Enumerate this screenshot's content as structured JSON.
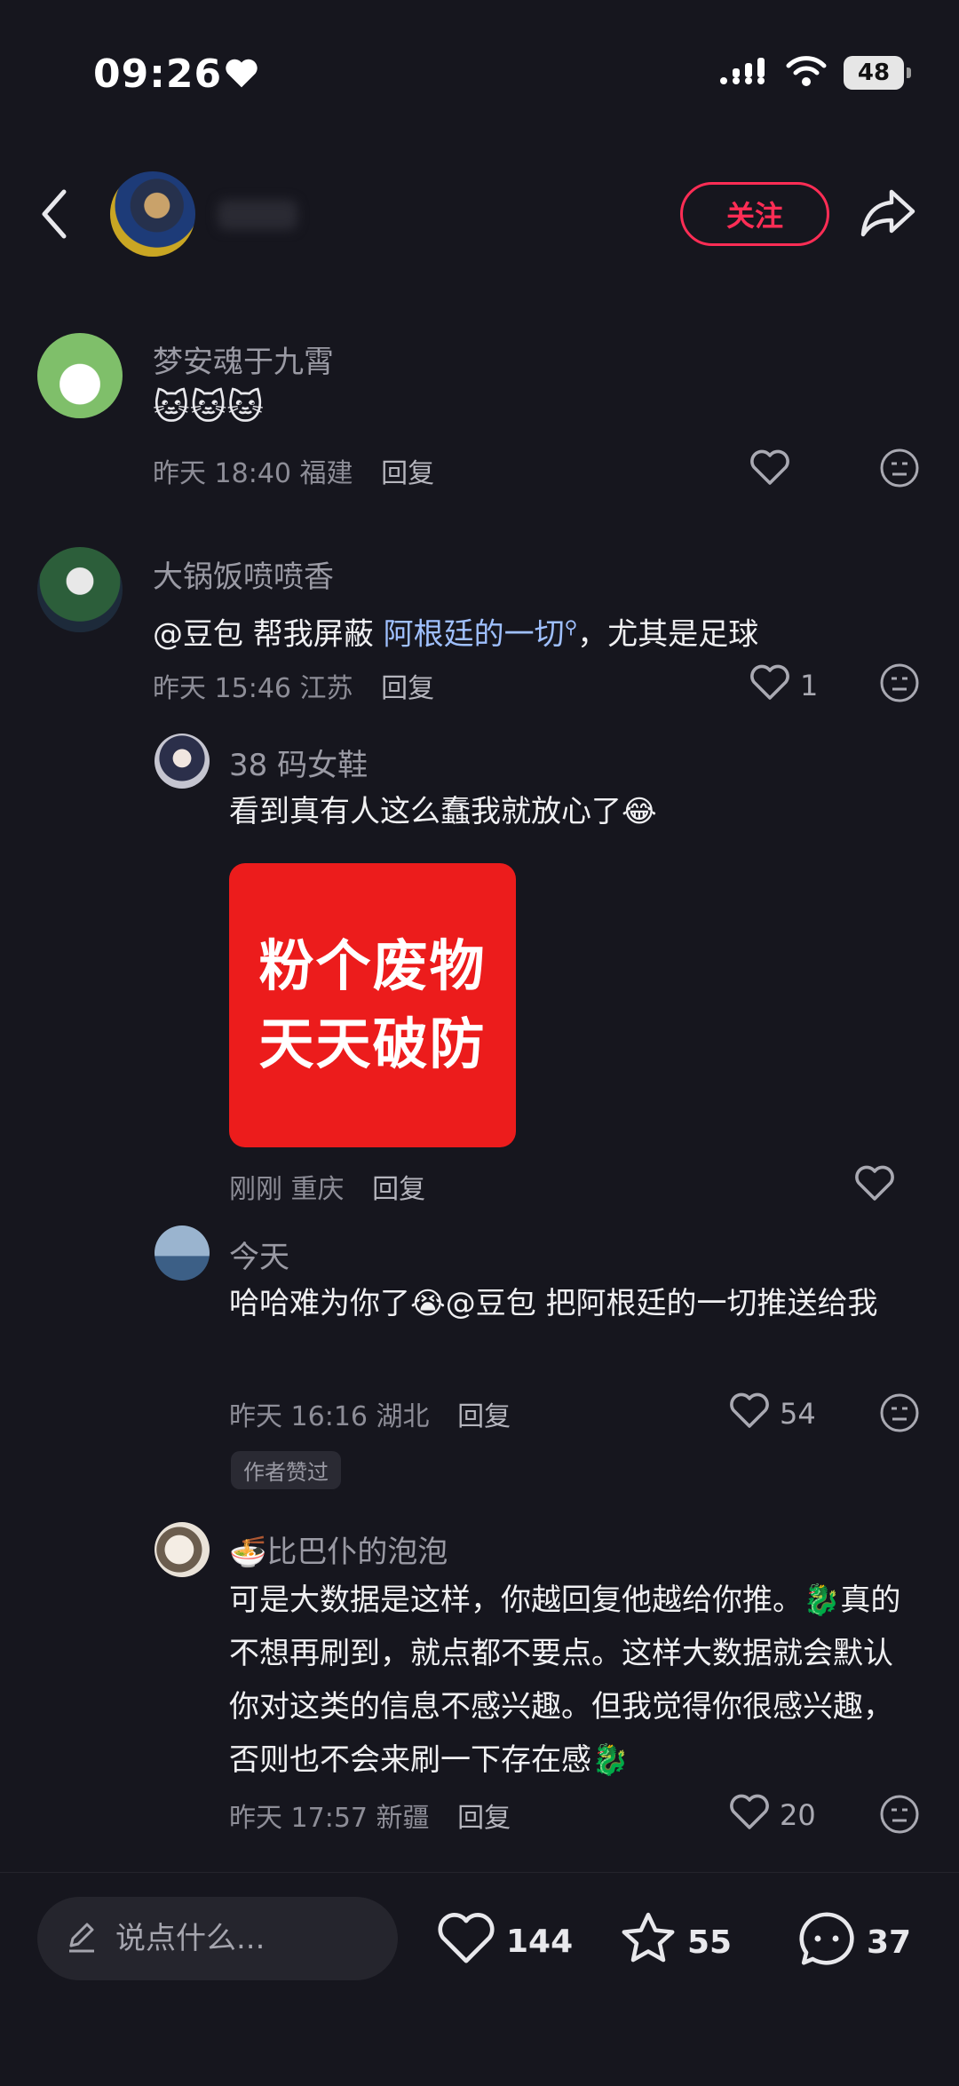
{
  "status_bar": {
    "time": "09:26",
    "battery": "48"
  },
  "header": {
    "follow_label": "关注"
  },
  "comments": [
    {
      "user": "梦安魂于九霄",
      "text": "",
      "time": "昨天 18:40",
      "location": "福建",
      "reply": "回复",
      "likes": ""
    },
    {
      "user": "大锅饭喷喷香",
      "text_prefix": "@豆包 帮我屏蔽 ",
      "text_highlight": "阿根廷的一切",
      "text_suffix": "，尤其是足球",
      "time": "昨天 15:46",
      "location": "江苏",
      "reply": "回复",
      "likes": "1"
    },
    {
      "user": "38 码女鞋",
      "text": "看到真有人这么蠢我就放心了😂",
      "image_text_line1": "粉个废物",
      "image_text_line2": "天天破防",
      "time": "刚刚",
      "location": "重庆",
      "reply": "回复",
      "likes": ""
    },
    {
      "user": "今天",
      "text": "哈哈难为你了😭@豆包 把阿根廷的一切推送给我",
      "time": "昨天 16:16",
      "location": "湖北",
      "reply": "回复",
      "likes": "54",
      "badge": "作者赞过"
    },
    {
      "user": "🍜比巴仆的泡泡",
      "text": "可是大数据是这样，你越回复他越给你推。🐉真的不想再刷到，就点都不要点。这样大数据就会默认你对这类的信息不感兴趣。但我觉得你很感兴趣，否则也不会来刷一下存在感🐉",
      "time": "昨天 17:57",
      "location": "新疆",
      "reply": "回复",
      "likes": "20"
    }
  ],
  "bottom_bar": {
    "input_placeholder": "说点什么...",
    "likes": "144",
    "favorites": "55",
    "comments": "37"
  }
}
